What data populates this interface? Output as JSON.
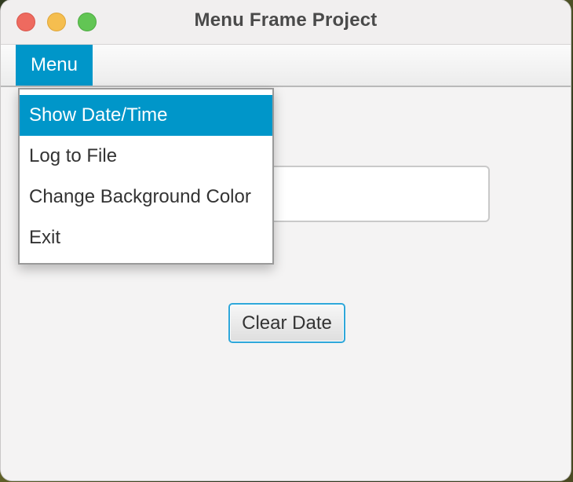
{
  "window": {
    "title": "Menu Frame Project"
  },
  "menubar": {
    "menu_label": "Menu"
  },
  "menu": {
    "items": [
      {
        "label": "Show Date/Time",
        "selected": true
      },
      {
        "label": "Log to File",
        "selected": false
      },
      {
        "label": "Change Background Color",
        "selected": false
      },
      {
        "label": "Exit",
        "selected": false
      }
    ]
  },
  "main": {
    "date_field_value": "",
    "clear_button_label": "Clear Date"
  },
  "colors": {
    "accent": "#0096c9",
    "focus_border": "#2ea7da"
  }
}
